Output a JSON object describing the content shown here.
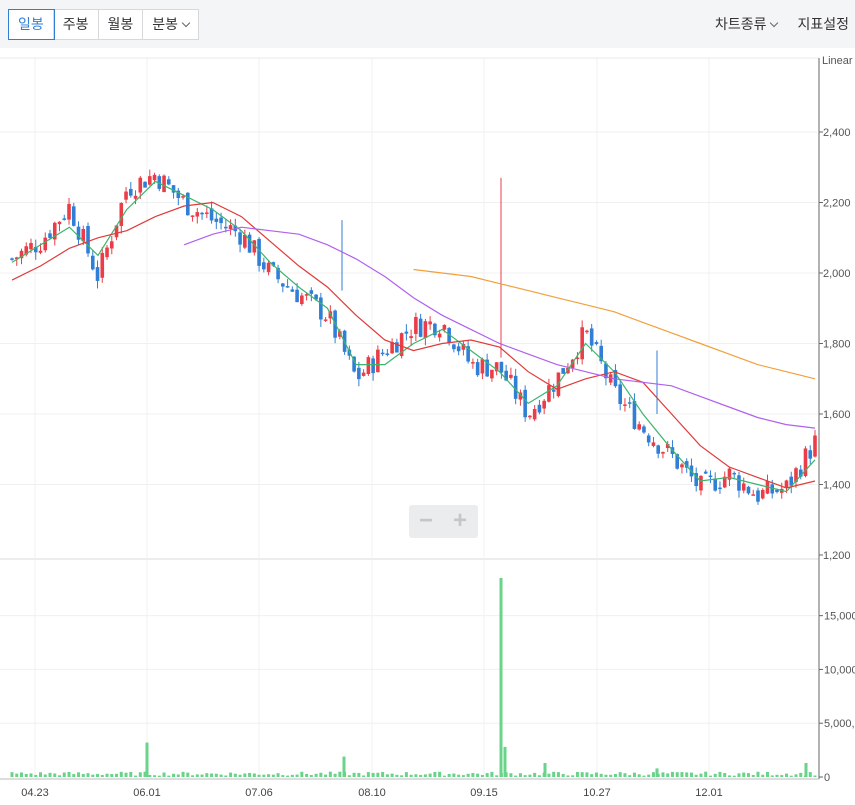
{
  "toolbar": {
    "periods": [
      "일봉",
      "주봉",
      "월봉",
      "분봉"
    ],
    "active_period": "일봉",
    "chart_type_label": "차트종류",
    "indicator_label": "지표설정"
  },
  "zoom": {
    "minus": "−",
    "plus": "+"
  },
  "colors": {
    "up": "#eb3d47",
    "down": "#2f7fd6",
    "ma5": "#3cb46e",
    "ma20": "#e03a3a",
    "ma60": "#b061ef",
    "ma120": "#f2a03c",
    "volume": "#69d38a",
    "grid": "#f0f0f0"
  },
  "chart_data": [
    {
      "type": "candlestick",
      "scale_label": "Linear",
      "ylim": [
        1200,
        2400
      ],
      "y_ticks": [
        "1,200",
        "1,400",
        "1,600",
        "1,800",
        "2,000",
        "2,200",
        "2,400"
      ],
      "x_ticks": [
        "04.23",
        "06.01",
        "07.06",
        "08.10",
        "09.15",
        "10.27",
        "12.01"
      ],
      "grid": true,
      "approx_close_path": [
        [
          "04.23",
          2040
        ],
        [
          "05.05",
          2090
        ],
        [
          "05.15",
          2190
        ],
        [
          "05.27",
          1990
        ],
        [
          "06.01",
          2240
        ],
        [
          "06.05",
          2280
        ],
        [
          "06.15",
          2200
        ],
        [
          "06.25",
          2150
        ],
        [
          "07.06",
          2110
        ],
        [
          "07.15",
          2000
        ],
        [
          "07.28",
          1940
        ],
        [
          "08.04",
          1880
        ],
        [
          "08.10",
          1700
        ],
        [
          "08.20",
          1780
        ],
        [
          "08.29",
          1850
        ],
        [
          "09.05",
          1860
        ],
        [
          "09.15",
          1740
        ],
        [
          "09.22",
          1730
        ],
        [
          "10.04",
          1600
        ],
        [
          "10.18",
          1700
        ],
        [
          "10.27",
          1830
        ],
        [
          "11.05",
          1660
        ],
        [
          "11.15",
          1560
        ],
        [
          "11.25",
          1480
        ],
        [
          "12.01",
          1390
        ],
        [
          "12.10",
          1430
        ],
        [
          "12.20",
          1370
        ],
        [
          "12.30",
          1390
        ],
        [
          "01.05",
          1520
        ]
      ],
      "series": [
        {
          "name": "MA5",
          "values": [
            2030,
            2080,
            2130,
            2050,
            2180,
            2260,
            2220,
            2180,
            2120,
            2030,
            1960,
            1900,
            1740,
            1740,
            1800,
            1840,
            1780,
            1720,
            1630,
            1680,
            1800,
            1720,
            1600,
            1500,
            1410,
            1420,
            1400,
            1380,
            1470
          ]
        },
        {
          "name": "MA20",
          "values": [
            1980,
            2020,
            2070,
            2100,
            2120,
            2160,
            2190,
            2200,
            2160,
            2090,
            2020,
            1960,
            1880,
            1810,
            1780,
            1800,
            1810,
            1790,
            1720,
            1670,
            1700,
            1720,
            1690,
            1600,
            1510,
            1450,
            1420,
            1390,
            1410
          ]
        },
        {
          "name": "MA60",
          "values": [
            null,
            null,
            null,
            null,
            null,
            null,
            2080,
            2110,
            2130,
            2120,
            2110,
            2080,
            2040,
            1990,
            1930,
            1880,
            1840,
            1800,
            1770,
            1740,
            1720,
            1700,
            1690,
            1680,
            1650,
            1620,
            1590,
            1570,
            1560
          ]
        },
        {
          "name": "MA120",
          "values": [
            null,
            null,
            null,
            null,
            null,
            null,
            null,
            null,
            null,
            null,
            null,
            null,
            null,
            null,
            2010,
            2000,
            1990,
            1970,
            1950,
            1930,
            1910,
            1890,
            1860,
            1830,
            1800,
            1770,
            1740,
            1720,
            1700
          ]
        }
      ]
    },
    {
      "type": "bar",
      "name": "volume",
      "ylim": [
        0,
        18500
      ],
      "y_ticks": [
        "0",
        "5,000,0",
        "10,000",
        "15,000,"
      ],
      "notable_spikes": [
        {
          "x": "06.01",
          "value": 3200
        },
        {
          "x": "07.30",
          "value": 1900
        },
        {
          "x": "09.15",
          "value": 18500
        },
        {
          "x": "09.17",
          "value": 2800
        },
        {
          "x": "10.12",
          "value": 1300
        },
        {
          "x": "11.15",
          "value": 800
        },
        {
          "x": "01.02",
          "value": 1300
        }
      ]
    }
  ]
}
